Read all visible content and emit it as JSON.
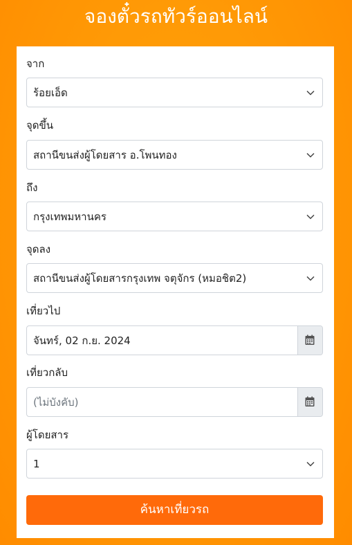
{
  "header": {
    "title": "จองตั๋วรถทัวร์ออนไลน์"
  },
  "form": {
    "from": {
      "label": "จาก",
      "value": "ร้อยเอ็ด"
    },
    "pickup": {
      "label": "จุดขึ้น",
      "value": "สถานีขนส่งผู้โดยสาร อ.โพนทอง"
    },
    "to": {
      "label": "ถึง",
      "value": "กรุงเทพมหานคร"
    },
    "dropoff": {
      "label": "จุดลง",
      "value": "สถานีขนส่งผู้โดยสารกรุงเทพ จตุจักร (หมอชิต2)"
    },
    "depart": {
      "label": "เที่ยวไป",
      "value": "จันทร์, 02 ก.ย. 2024"
    },
    "return": {
      "label": "เที่ยวกลับ",
      "placeholder": "(ไม่บังคับ)"
    },
    "passengers": {
      "label": "ผู้โดยสาร",
      "value": "1"
    },
    "search_label": "ค้นหาเที่ยวรถ"
  },
  "icons": {
    "dropdown": "chevron-down-icon",
    "calendar": "calendar-icon"
  }
}
